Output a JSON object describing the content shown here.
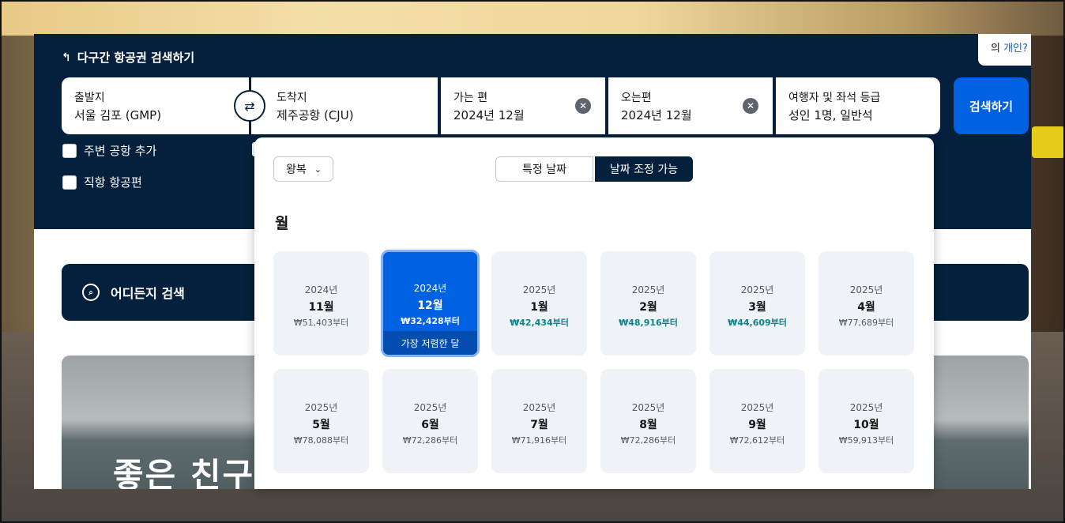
{
  "hero": {
    "title": "다구간 항공권 검색하기",
    "title_icon": "multi-city-icon"
  },
  "privacy": {
    "prefix": "의 ",
    "link": "개인?"
  },
  "search": {
    "from": {
      "label": "출발지",
      "value": "서울 김포 (GMP)"
    },
    "to": {
      "label": "도착지",
      "value": "제주공항 (CJU)"
    },
    "depart": {
      "label": "가는 편",
      "value": "2024년 12월"
    },
    "return": {
      "label": "오는편",
      "value": "2024년 12월"
    },
    "travellers": {
      "label": "여행자 및 좌석 등급",
      "value": "성인 1명, 일반석"
    },
    "swap_icon": "⇄",
    "clear_icon": "✕",
    "button": "검색하기"
  },
  "options": {
    "nearby": "주변 공항 추가",
    "direct": "직항 항공편"
  },
  "anywhere": {
    "label": "어디든지 검색",
    "icon": "search-globe-icon"
  },
  "promo": {
    "text": "좋은 친구"
  },
  "picker": {
    "trip_type": "왕복",
    "chevron": "⌄",
    "mode_specific": "특정 날짜",
    "mode_flexible": "날짜 조정 가능",
    "heading": "월",
    "cheapest_label": "가장 저렴한 달",
    "months": [
      {
        "year": "2024년",
        "month": "11월",
        "price": "₩51,403부터",
        "low": false,
        "selected": false
      },
      {
        "year": "2024년",
        "month": "12월",
        "price": "₩32,428부터",
        "low": false,
        "selected": true
      },
      {
        "year": "2025년",
        "month": "1월",
        "price": "₩42,434부터",
        "low": true,
        "selected": false
      },
      {
        "year": "2025년",
        "month": "2월",
        "price": "₩48,916부터",
        "low": true,
        "selected": false
      },
      {
        "year": "2025년",
        "month": "3월",
        "price": "₩44,609부터",
        "low": true,
        "selected": false
      },
      {
        "year": "2025년",
        "month": "4월",
        "price": "₩77,689부터",
        "low": false,
        "selected": false
      },
      {
        "year": "2025년",
        "month": "5월",
        "price": "₩78,088부터",
        "low": false,
        "selected": false
      },
      {
        "year": "2025년",
        "month": "6월",
        "price": "₩72,286부터",
        "low": false,
        "selected": false
      },
      {
        "year": "2025년",
        "month": "7월",
        "price": "₩71,916부터",
        "low": false,
        "selected": false
      },
      {
        "year": "2025년",
        "month": "8월",
        "price": "₩72,286부터",
        "low": false,
        "selected": false
      },
      {
        "year": "2025년",
        "month": "9월",
        "price": "₩72,612부터",
        "low": false,
        "selected": false
      },
      {
        "year": "2025년",
        "month": "10월",
        "price": "₩59,913부터",
        "low": false,
        "selected": false
      }
    ]
  },
  "colors": {
    "navy": "#05203c",
    "primary": "#0062e3",
    "low_price": "#0c838a"
  }
}
